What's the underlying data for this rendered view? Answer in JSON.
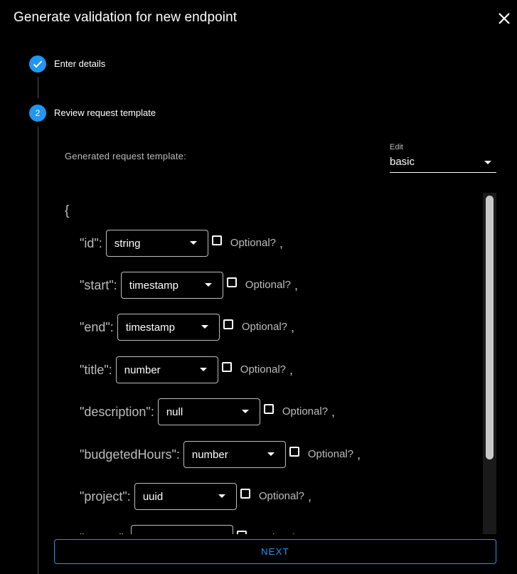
{
  "dialog": {
    "title": "Generate validation for new endpoint",
    "close_icon": "close-icon"
  },
  "stepper": {
    "steps": [
      {
        "label": "Enter details",
        "state": "completed",
        "icon": "check-icon"
      },
      {
        "label": "Review request template",
        "state": "active",
        "number": "2"
      }
    ]
  },
  "template": {
    "label": "Generated request template:",
    "edit": {
      "label": "Edit",
      "value": "basic"
    },
    "open_brace": "{",
    "optional_label": "Optional?",
    "comma": ",",
    "fields": [
      {
        "key": "\"id\":",
        "type": "string"
      },
      {
        "key": "\"start\":",
        "type": "timestamp"
      },
      {
        "key": "\"end\":",
        "type": "timestamp"
      },
      {
        "key": "\"title\":",
        "type": "number"
      },
      {
        "key": "\"description\":",
        "type": "null"
      },
      {
        "key": "\"budgetedHours\":",
        "type": "number"
      },
      {
        "key": "\"project\":",
        "type": "uuid"
      },
      {
        "key": "\"owner\":",
        "type": ""
      }
    ]
  },
  "actions": {
    "next_label": "NEXT"
  },
  "colors": {
    "accent": "#2196f3",
    "background": "#000000",
    "muted_text": "#bdbdbd"
  }
}
